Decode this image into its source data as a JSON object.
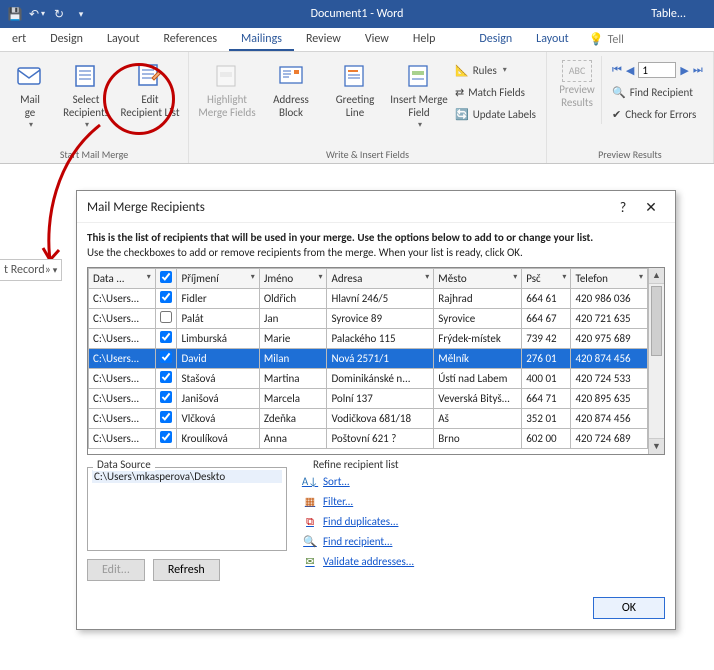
{
  "titlebar": {
    "title": "Document1 - Word",
    "context_label": "Table..."
  },
  "tabs": {
    "items": [
      "ert",
      "Design",
      "Layout",
      "References",
      "Mailings",
      "Review",
      "View",
      "Help"
    ],
    "active": "Mailings",
    "context": [
      "Design",
      "Layout"
    ],
    "tell": "Tell"
  },
  "ribbon": {
    "start": {
      "label": "Start Mail Merge",
      "mail_merge": "Mail\nge",
      "select_recipients": "Select\nRecipients",
      "edit_recipient_list": "Edit\nRecipient List"
    },
    "write": {
      "label": "Write & Insert Fields",
      "highlight": "Highlight\nMerge Fields",
      "address": "Address\nBlock",
      "greeting": "Greeting\nLine",
      "insert_merge": "Insert Merge\nField",
      "rules": "Rules",
      "match": "Match Fields",
      "update": "Update Labels"
    },
    "preview": {
      "label": "Preview Results",
      "preview_results": "Preview\nResults",
      "record_value": "1",
      "find": "Find Recipient",
      "check": "Check for Errors"
    }
  },
  "left_frag": "t Record»",
  "dialog": {
    "title": "Mail Merge Recipients",
    "instr_bold": "This is the list of recipients that will be used in your merge.  Use the options below to add to or change your list.",
    "instr_rest": "Use the checkboxes to add or remove recipients from the merge.  When your list is ready, click OK.",
    "columns": [
      "Data ...",
      "",
      "Příjmení",
      "Jméno",
      "Adresa",
      "Město",
      "Psč",
      "Telefon"
    ],
    "rows": [
      {
        "ds": "C:\\Users...",
        "chk": true,
        "p": "Fidler",
        "j": "Oldřich",
        "a": "Hlavní 246/5",
        "m": "Rajhrad",
        "psc": "664 61",
        "t": "420 986 036"
      },
      {
        "ds": "C:\\Users...",
        "chk": false,
        "p": "Palát",
        "j": "Jan",
        "a": "Syrovice 89",
        "m": "Syrovice",
        "psc": "664 67",
        "t": "420 721 635"
      },
      {
        "ds": "C:\\Users...",
        "chk": true,
        "p": "Limburská",
        "j": "Marie",
        "a": "Palackého 115",
        "m": "Frýdek-místek",
        "psc": "739 42",
        "t": "420 975 689"
      },
      {
        "ds": "C:\\Users...",
        "chk": true,
        "p": "David",
        "j": "Milan",
        "a": "Nová 2571/1",
        "m": "Mělník",
        "psc": "276 01",
        "t": "420 874 456",
        "sel": true
      },
      {
        "ds": "C:\\Users...",
        "chk": true,
        "p": "Stašová",
        "j": "Martina",
        "a": "Dominikánské n...",
        "m": "Ústí nad Labem",
        "psc": "400 01",
        "t": "420 724 533"
      },
      {
        "ds": "C:\\Users...",
        "chk": true,
        "p": "Janišová",
        "j": "Marcela",
        "a": "Polní 137",
        "m": "Veverská Bityš...",
        "psc": "664 71",
        "t": "420 895 635"
      },
      {
        "ds": "C:\\Users...",
        "chk": true,
        "p": "Vlčková",
        "j": "Zdeňka",
        "a": "Vodičkova 681/18",
        "m": "Aš",
        "psc": "352 01",
        "t": "420 874 456"
      },
      {
        "ds": "C:\\Users...",
        "chk": true,
        "p": "Kroulíková",
        "j": "Anna",
        "a": "Poštovní 621 ?",
        "m": "Brno",
        "psc": "602 00",
        "t": "420 724 689"
      }
    ],
    "data_source": {
      "label": "Data Source",
      "item": "C:\\Users\\mkasperova\\Deskto",
      "edit": "Edit...",
      "refresh": "Refresh"
    },
    "refine": {
      "label": "Refine recipient list",
      "sort": "Sort...",
      "filter": "Filter...",
      "dups": "Find duplicates...",
      "find": "Find recipient...",
      "validate": "Validate addresses..."
    },
    "ok": "OK"
  }
}
